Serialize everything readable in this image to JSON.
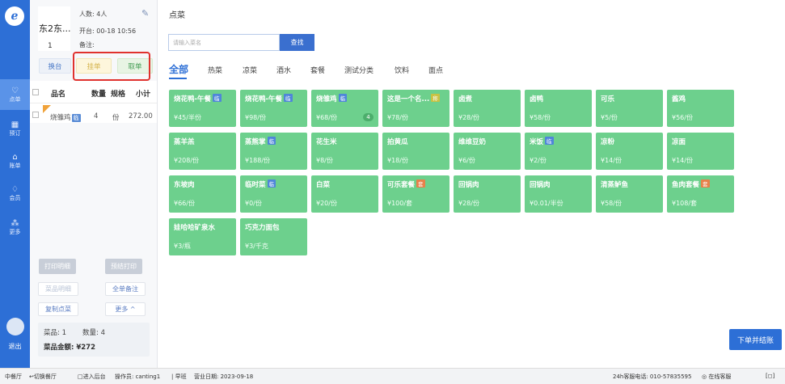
{
  "nav": {
    "items": [
      {
        "icon": "utensils-icon",
        "label": "点单",
        "glyph": "♡"
      },
      {
        "icon": "calendar-icon",
        "label": "预订",
        "glyph": "▦"
      },
      {
        "icon": "chart-icon",
        "label": "账单",
        "glyph": "⌂"
      },
      {
        "icon": "member-icon",
        "label": "会员",
        "glyph": "♢"
      },
      {
        "icon": "more-icon",
        "label": "更多",
        "glyph": "⁂"
      }
    ],
    "logout_label": "退出",
    "active_color": "#5a93e8",
    "rail_color": "#2d6fd6"
  },
  "order": {
    "table_name": "东2东...",
    "table_seq": "1",
    "people": "人数: 4人",
    "open_time": "开台: 00-18 10:56",
    "note": "备注:",
    "switch_label": "换台",
    "hang_label": "挂单",
    "take_label": "取单",
    "columns": {
      "name": "品名",
      "qty": "数量",
      "spec": "规格",
      "subtotal": "小计"
    },
    "items": [
      {
        "name": "烧雏鸡",
        "tag": "临",
        "qty": "4",
        "unit": "份",
        "subtotal": "272.00"
      }
    ],
    "print_detail_label": "打印明细",
    "pre_print_label": "预结打印",
    "dish_detail_label": "菜品明细",
    "all_note_label": "全单备注",
    "copy_label": "复制点菜",
    "more_label": "更多 ^",
    "summary": {
      "dishes": "菜品: 1",
      "quantity": "数量: 4",
      "amount": "菜品金额: ¥272"
    }
  },
  "main": {
    "title": "点菜",
    "search_placeholder": "请输入菜名",
    "search_button": "查找",
    "tabs": [
      "全部",
      "热菜",
      "凉菜",
      "酒水",
      "套餐",
      "测试分类",
      "饮料",
      "面点"
    ],
    "dishes": [
      {
        "name": "烧花鸭-午餐",
        "badge": "临",
        "badge_color": "#4f86d9",
        "price": "¥45/半份"
      },
      {
        "name": "烧花鸭-午餐",
        "badge": "临",
        "badge_color": "#4f86d9",
        "price": "¥98/份"
      },
      {
        "name": "烧雏鸡",
        "badge": "临",
        "badge_color": "#4f86d9",
        "price": "¥68/份",
        "count": "4"
      },
      {
        "name": "这是一个名...",
        "badge": "称",
        "badge_color": "#c8c243",
        "price": "¥78/份"
      },
      {
        "name": "卤煮",
        "price": "¥28/份"
      },
      {
        "name": "卤鸭",
        "price": "¥58/份"
      },
      {
        "name": "可乐",
        "price": "¥5/份"
      },
      {
        "name": "酱鸡",
        "price": "¥56/份"
      },
      {
        "name": "蒸羊羔",
        "price": "¥208/份"
      },
      {
        "name": "蒸熊掌",
        "badge": "临",
        "badge_color": "#4f86d9",
        "price": "¥188/份"
      },
      {
        "name": "花生米",
        "price": "¥8/份"
      },
      {
        "name": "拍黄瓜",
        "price": "¥18/份"
      },
      {
        "name": "维维豆奶",
        "price": "¥6/份"
      },
      {
        "name": "米饭",
        "badge": "临",
        "badge_color": "#4f86d9",
        "price": "¥2/份"
      },
      {
        "name": "凉粉",
        "price": "¥14/份"
      },
      {
        "name": "凉面",
        "price": "¥14/份"
      },
      {
        "name": "东坡肉",
        "price": "¥66/份"
      },
      {
        "name": "临时菜",
        "badge": "临",
        "badge_color": "#4f86d9",
        "price": "¥0/份"
      },
      {
        "name": "白菜",
        "price": "¥20/份"
      },
      {
        "name": "可乐套餐",
        "badge": "套",
        "badge_color": "#e8804a",
        "price": "¥100/套"
      },
      {
        "name": "回锅肉",
        "price": "¥28/份"
      },
      {
        "name": "回锅肉",
        "price": "¥0.01/半份"
      },
      {
        "name": "清蒸鲈鱼",
        "price": "¥58/份"
      },
      {
        "name": "鱼肉套餐",
        "badge": "套",
        "badge_color": "#e8804a",
        "price": "¥108/套"
      },
      {
        "name": "娃哈哈矿泉水",
        "price": "¥3/瓶"
      },
      {
        "name": "巧克力面包",
        "price": "¥3/千克"
      }
    ],
    "submit_label": "下单并结账",
    "card_color": "#6dd08d"
  },
  "status": {
    "mode": "中餐厅",
    "switch_restaurant": "↩切换餐厅",
    "backend": "□进入后台",
    "operator": "操作员: canting1",
    "shift": "| 早班",
    "business_date": "营业日期: 2023-09-18",
    "hotline": "24h客服电话: 010-57835595",
    "online_service": "在线客服"
  }
}
